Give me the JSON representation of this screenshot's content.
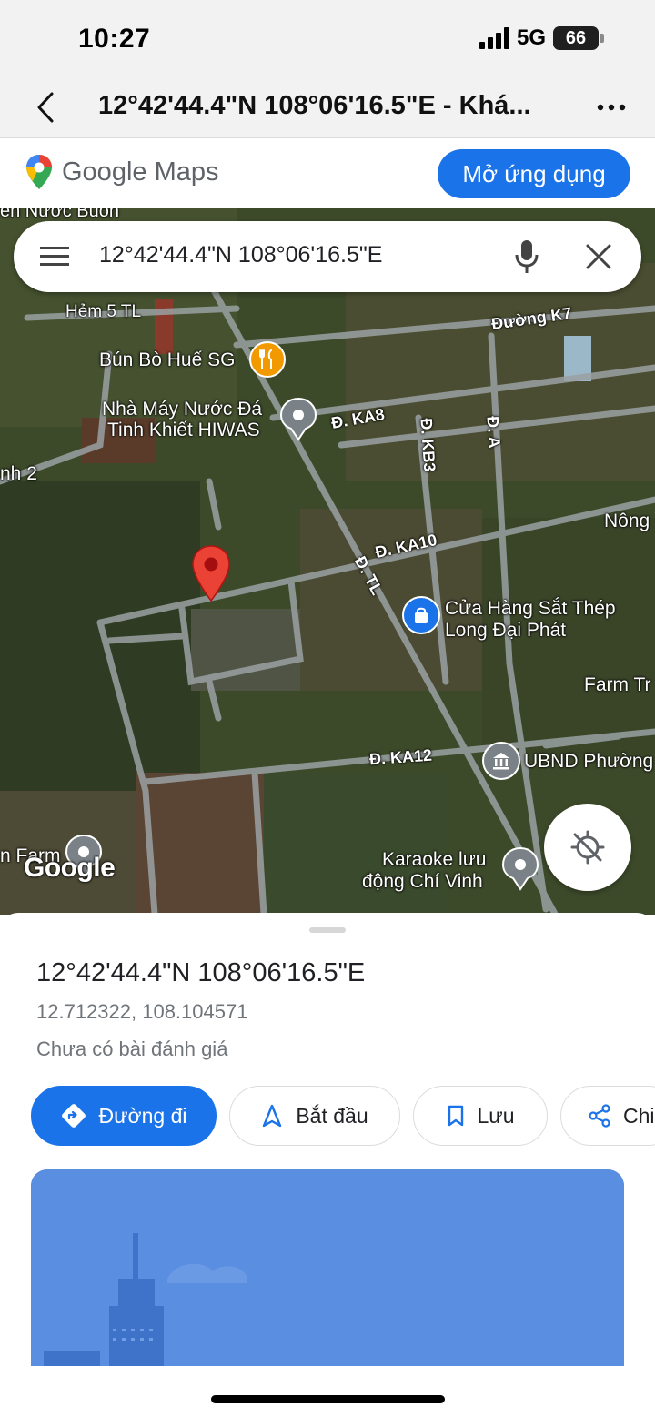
{
  "status_bar": {
    "time": "10:27",
    "network": "5G",
    "battery": "66"
  },
  "browser": {
    "title": "12°42'44.4\"N 108°06'16.5\"E - Khá...",
    "back_icon": "chevron-left-icon",
    "more_icon": "more-horizontal-icon"
  },
  "maps_banner": {
    "logo_text": "Google Maps",
    "open_app_label": "Mở ứng dụng"
  },
  "search": {
    "query": "12°42'44.4\"N 108°06'16.5\"E"
  },
  "map": {
    "labels": {
      "top_partial": "ên Nước Buôn",
      "hem5": "Hẻm 5 TL",
      "duong_k7": "Đường K7",
      "bun_bo": "Bún Bò Huế SG",
      "nha_may_1": "Nhà Máy Nước Đá",
      "nha_may_2": "Tinh Khiết HIWAS",
      "ka8": "Đ. KA8",
      "kb3": "Đ. KB3",
      "da": "Đ. A",
      "nh2": "nh 2",
      "nong": "Nông",
      "ka10": "Đ. KA10",
      "tl": "Đ. TL",
      "cua_hang_1": "Cửa Hàng Sắt Thép",
      "cua_hang_2": "Long Đại Phát",
      "farm_tr": "Farm Tr",
      "ka12": "Đ. KA12",
      "ubnd": "UBND Phường",
      "n_farm": "n Farm",
      "karaoke_1": "Karaoke lưu",
      "karaoke_2": "động Chí Vinh",
      "watermark": "Google"
    }
  },
  "place": {
    "title": "12°42'44.4\"N 108°06'16.5\"E",
    "decimal": "12.712322, 108.104571",
    "reviews": "Chưa có bài đánh giá"
  },
  "actions": [
    {
      "label": "Đường đi",
      "icon": "directions-icon"
    },
    {
      "label": "Bắt đầu",
      "icon": "navigation-arrow-icon"
    },
    {
      "label": "Lưu",
      "icon": "bookmark-icon"
    },
    {
      "label": "Chi",
      "icon": "share-icon"
    }
  ],
  "colors": {
    "accent": "#1a73e8",
    "pin_red": "#ea4335",
    "poi_orange": "#f29900",
    "poi_blue": "#1a73e8",
    "poi_gray": "#7a8288"
  }
}
